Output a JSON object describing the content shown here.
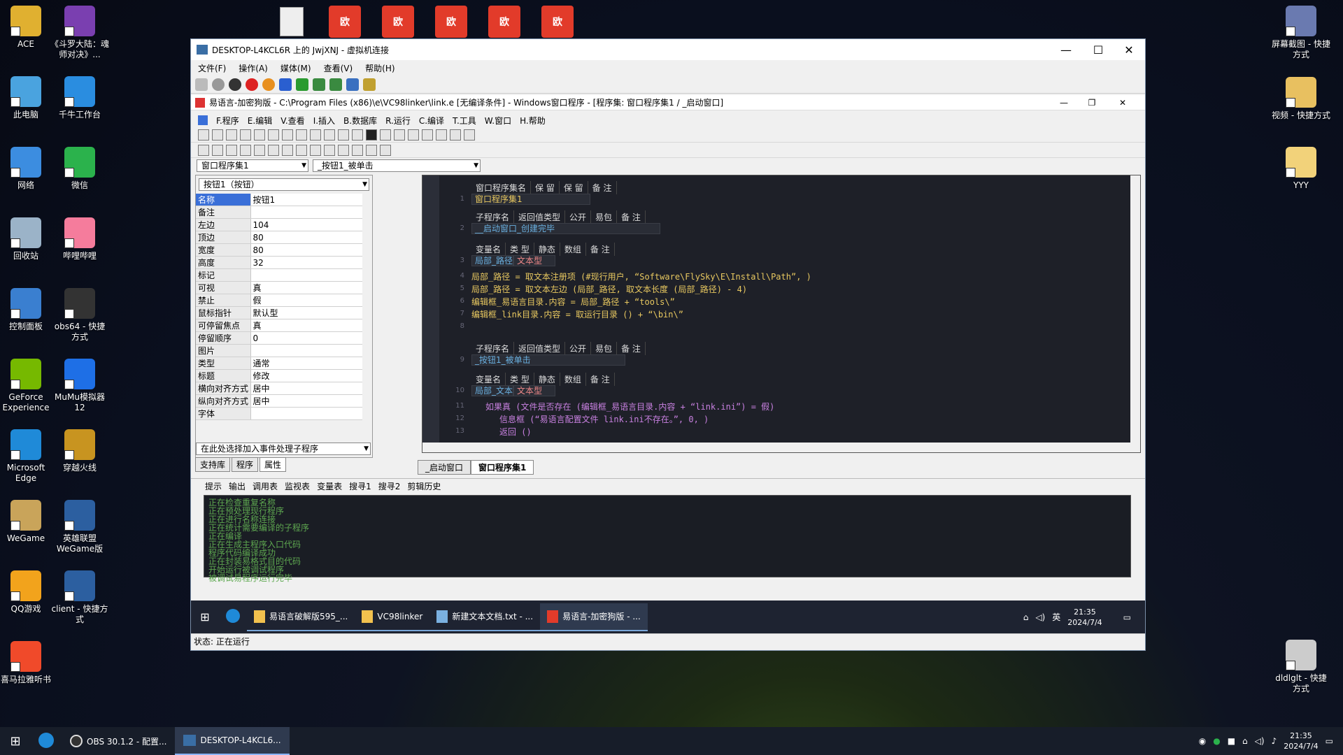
{
  "desktop": {
    "icons_left": [
      {
        "label": "ACE",
        "color": "#e0b030"
      },
      {
        "label": "《斗罗大陆：魂师对决》...",
        "color": "#7a3fb0"
      },
      {
        "label": "此电脑",
        "color": "#4aa3df"
      },
      {
        "label": "千牛工作台",
        "color": "#2a8de0"
      },
      {
        "label": "网络",
        "color": "#3c8de0"
      },
      {
        "label": "微信",
        "color": "#2bb24c"
      },
      {
        "label": "回收站",
        "color": "#9bb3c8"
      },
      {
        "label": "哔哩哔哩",
        "color": "#f57c9c"
      },
      {
        "label": "控制面板",
        "color": "#3a7fd0"
      },
      {
        "label": "obs64 - 快捷方式",
        "color": "#333333"
      },
      {
        "label": "GeForce Experience",
        "color": "#76b900"
      },
      {
        "label": "MuMu模拟器12",
        "color": "#1e6fe6"
      },
      {
        "label": "Microsoft Edge",
        "color": "#1f8ad8"
      },
      {
        "label": "穿越火线",
        "color": "#c89420"
      },
      {
        "label": "WeGame",
        "color": "#c9a45a"
      },
      {
        "label": "英雄联盟WeGame版",
        "color": "#2c5fa0"
      },
      {
        "label": "QQ游戏",
        "color": "#f2a31c"
      },
      {
        "label": "client - 快捷方式",
        "color": "#2c5fa0"
      },
      {
        "label": "喜马拉雅听书",
        "color": "#f04a2a"
      }
    ],
    "icons_right": [
      {
        "label": "屏幕截图 - 快捷方式",
        "color": "#6a7ab0"
      },
      {
        "label": "视频 - 快捷方式",
        "color": "#e8c060"
      },
      {
        "label": "YYY",
        "color": "#f2d27a"
      },
      {
        "label": "dldlglt - 快捷方式",
        "color": "#cccccc"
      }
    ],
    "top_icons": [
      "欧",
      "欧",
      "欧",
      "欧",
      "欧"
    ]
  },
  "vm": {
    "title": "DESKTOP-L4KCL6R 上的 JwjXNJ - 虚拟机连接",
    "menu": [
      "文件(F)",
      "操作(A)",
      "媒体(M)",
      "查看(V)",
      "帮助(H)"
    ],
    "status": "状态: 正在运行"
  },
  "ide": {
    "title": "易语言-加密狗版 - C:\\Program Files (x86)\\e\\VC98linker\\link.e [无编译条件] - Windows窗口程序 - [程序集: 窗口程序集1 / _启动窗口]",
    "menu": [
      "F.程序",
      "E.编辑",
      "V.查看",
      "I.插入",
      "B.数据库",
      "R.运行",
      "C.编译",
      "T.工具",
      "W.窗口",
      "H.帮助"
    ],
    "select_left": "窗口程序集1",
    "select_right": "_按钮1_被单击",
    "prop_combo": "按钮1（按钮）",
    "properties": [
      {
        "k": "名称",
        "v": "按钮1"
      },
      {
        "k": "备注",
        "v": ""
      },
      {
        "k": "左边",
        "v": "104"
      },
      {
        "k": "顶边",
        "v": "80"
      },
      {
        "k": "宽度",
        "v": "80"
      },
      {
        "k": "高度",
        "v": "32"
      },
      {
        "k": "标记",
        "v": ""
      },
      {
        "k": "可视",
        "v": "真"
      },
      {
        "k": "禁止",
        "v": "假"
      },
      {
        "k": "鼠标指针",
        "v": "默认型"
      },
      {
        "k": "可停留焦点",
        "v": "真"
      },
      {
        "k": "停留顺序",
        "v": "0"
      },
      {
        "k": "图片",
        "v": ""
      },
      {
        "k": "类型",
        "v": "通常"
      },
      {
        "k": "标题",
        "v": "修改"
      },
      {
        "k": "横向对齐方式",
        "v": "居中"
      },
      {
        "k": "纵向对齐方式",
        "v": "居中"
      },
      {
        "k": "字体",
        "v": ""
      }
    ],
    "event_combo": "在此处选择加入事件处理子程序",
    "pane_tabs": [
      "支持库",
      "程序",
      "属性"
    ],
    "code": {
      "h1": [
        "窗口程序集名",
        "保 留",
        "保 留",
        "备 注"
      ],
      "assembly_name": "窗口程序集1",
      "h2": [
        "子程序名",
        "返回值类型",
        "公开",
        "易包",
        "备 注"
      ],
      "sub1": "__启动窗口_创建完毕",
      "h3": [
        "变量名",
        "类 型",
        "静态",
        "数组",
        "备 注"
      ],
      "var1": [
        "局部_路径",
        "文本型"
      ],
      "lines1": [
        "局部_路径 = 取文本注册项 (#现行用户, “Software\\FlySky\\E\\Install\\Path”, )",
        "局部_路径 = 取文本左边 (局部_路径, 取文本长度 (局部_路径) - 4)",
        "编辑框_易语言目录.内容 = 局部_路径 + “tools\\”",
        "编辑框_link目录.内容 = 取运行目录 () + “\\bin\\”"
      ],
      "sub2": "_按钮1_被单击",
      "var2": [
        "局部_文本",
        "文本型"
      ],
      "lines2": [
        "如果真 (文件是否存在 (编辑框_易语言目录.内容 + “link.ini”) = 假)",
        "信息框 (“易语言配置文件 link.ini不存在。”, 0, )",
        "返回 ()"
      ],
      "line_numbers": [
        "1",
        "2",
        "3",
        "4",
        "5",
        "6",
        "7",
        "8",
        "9",
        "10",
        "11",
        "12",
        "13"
      ]
    },
    "code_tabs": [
      "_启动窗口",
      "窗口程序集1"
    ],
    "output_tabs": [
      "提示",
      "输出",
      "调用表",
      "监视表",
      "变量表",
      "搜寻1",
      "搜寻2",
      "剪辑历史"
    ],
    "output_lines": [
      "正在检查重复名称",
      "正在预处理现行程序",
      "正在进行名称连接",
      "正在统计需要编译的子程序",
      "正在编译",
      "正在生成主程序入口代码",
      "程序代码编译成功",
      "正在封装易格式目的代码",
      "开始运行被调试程序",
      "被调试易程序运行完毕"
    ]
  },
  "guest_taskbar": {
    "items": [
      "易语言破解版595_...",
      "VC98linker",
      "新建文本文档.txt - ...",
      "易语言-加密狗版 - ..."
    ],
    "lang": "英",
    "time": "21:35",
    "date": "2024/7/4"
  },
  "host_taskbar": {
    "items": [
      "OBS 30.1.2 - 配置...",
      "DESKTOP-L4KCL6..."
    ],
    "time": "21:35",
    "date": "2024/7/4"
  }
}
